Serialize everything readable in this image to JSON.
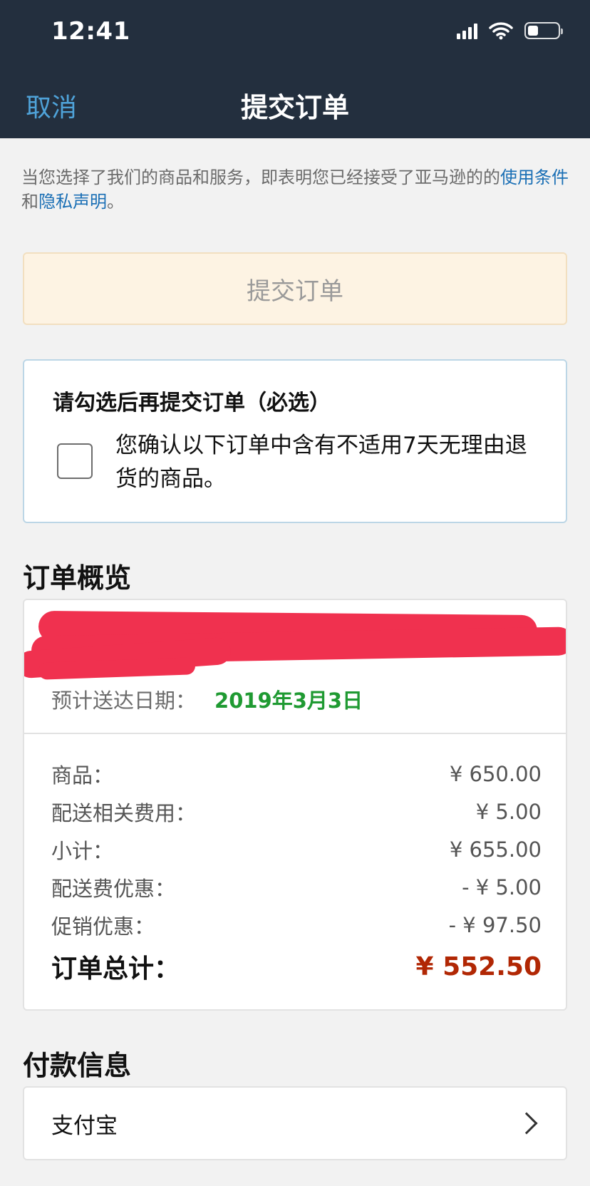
{
  "status_bar": {
    "time": "12:41",
    "battery_level": 0.35
  },
  "nav": {
    "cancel_label": "取消",
    "title": "提交订单"
  },
  "legal": {
    "text_before": "当您选择了我们的商品和服务，即表明您已经接受了亚马逊的的",
    "terms_link": "使用条件",
    "and_text": "和",
    "privacy_link": "隐私声明",
    "period": "。"
  },
  "submit_button": {
    "label": "提交订单",
    "enabled": false
  },
  "confirm": {
    "title": "请勾选后再提交订单（必选）",
    "checkbox_text": "您确认以下订单中含有不适用7天无理由退货的商品。",
    "checked": false
  },
  "order_summary": {
    "title": "订单概览",
    "delivery_label": "预计送达日期：",
    "delivery_date": "2019年3月3日",
    "lines": [
      {
        "label": "商品：",
        "value": "¥ 650.00"
      },
      {
        "label": "配送相关费用：",
        "value": "¥ 5.00"
      },
      {
        "label": "小计：",
        "value": "¥ 655.00"
      },
      {
        "label": "配送费优惠：",
        "value": "- ¥ 5.00"
      },
      {
        "label": "促销优惠：",
        "value": "- ¥ 97.50"
      }
    ],
    "total_label": "订单总计：",
    "total_value": "¥ 552.50"
  },
  "payment": {
    "title": "付款信息",
    "method": "支付宝"
  },
  "colors": {
    "header_bg": "#232f3e",
    "link": "#1a6fb5",
    "cancel": "#4fa3d9",
    "delivery_green": "#1f9a32",
    "total_red": "#b12704",
    "redaction": "#f0314f"
  },
  "icons": [
    "signal-icon",
    "wifi-icon",
    "battery-icon",
    "chevron-right-icon"
  ]
}
